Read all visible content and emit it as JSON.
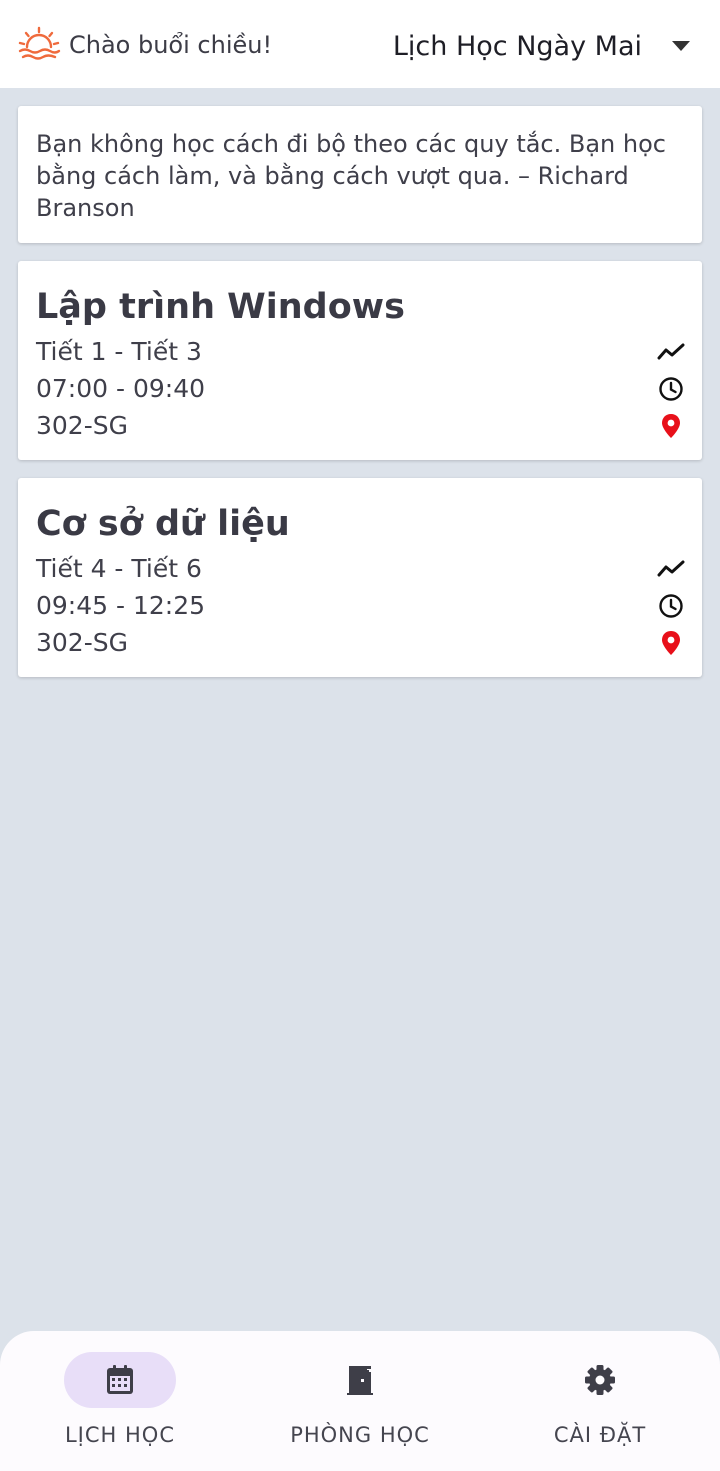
{
  "header": {
    "greeting": "Chào buổi chiều!",
    "schedule_select": "Lịch Học Ngày Mai",
    "sun_icon": "sunset-icon",
    "accent_color": "#ef6a3c"
  },
  "quote": {
    "text": "Bạn không học cách đi bộ theo các quy tắc. Bạn học bằng cách làm, và bằng cách vượt qua. – Richard Branson"
  },
  "classes": [
    {
      "name": "Lập trình Windows",
      "periods": "Tiết 1 - Tiết 3",
      "time": "07:00 - 09:40",
      "room": "302-SG"
    },
    {
      "name": "Cơ sở dữ liệu",
      "periods": "Tiết 4 - Tiết 6",
      "time": "09:45 - 12:25",
      "room": "302-SG"
    }
  ],
  "nav": [
    {
      "label": "LỊCH HỌC",
      "icon": "calendar-icon",
      "active": true
    },
    {
      "label": "PHÒNG HỌC",
      "icon": "door-icon",
      "active": false
    },
    {
      "label": "CÀI ĐẶT",
      "icon": "gear-icon",
      "active": false
    }
  ],
  "colors": {
    "location_pin": "#e8101a",
    "active_pill": "#e8def8",
    "background": "#dce2ea"
  }
}
